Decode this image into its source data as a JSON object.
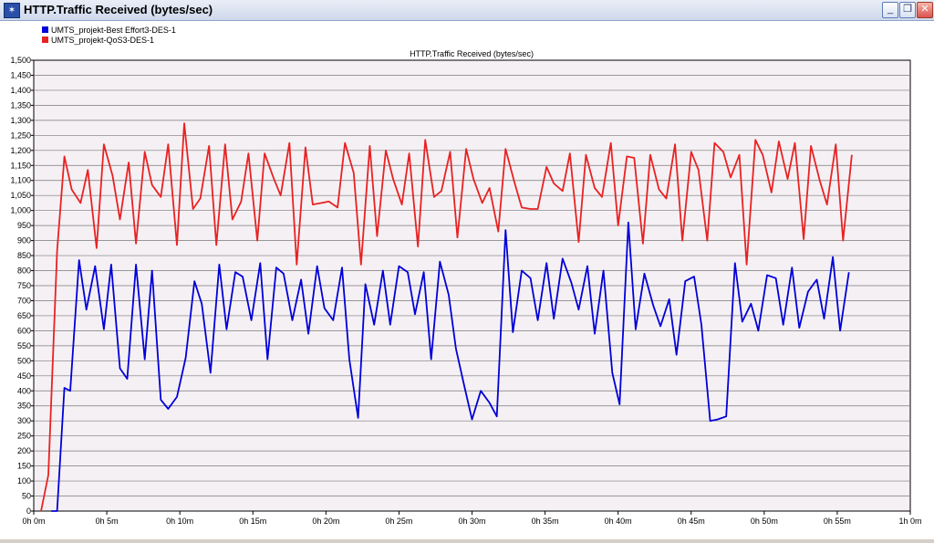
{
  "window": {
    "title": "HTTP.Traffic Received (bytes/sec)"
  },
  "colors": {
    "plot_bg": "#f5f0f4",
    "grid": "#7a7a7a",
    "series1": "#0000d8",
    "series2": "#e82222"
  },
  "chart_data": {
    "type": "line",
    "title": "HTTP.Traffic Received (bytes/sec)",
    "xlabel": "",
    "ylabel": "",
    "xlim": [
      0,
      60
    ],
    "ylim": [
      0,
      1500
    ],
    "grid": true,
    "legend_position": "top-left",
    "y_ticks": [
      0,
      50,
      100,
      150,
      200,
      250,
      300,
      350,
      400,
      450,
      500,
      550,
      600,
      650,
      700,
      750,
      800,
      850,
      900,
      950,
      1000,
      1050,
      1100,
      1150,
      1200,
      1250,
      1300,
      1350,
      1400,
      1450,
      1500
    ],
    "y_tick_labels": [
      "0",
      "50",
      "100",
      "150",
      "200",
      "250",
      "300",
      "350",
      "400",
      "450",
      "500",
      "550",
      "600",
      "650",
      "700",
      "750",
      "800",
      "850",
      "900",
      "950",
      "1,000",
      "1,050",
      "1,100",
      "1,150",
      "1,200",
      "1,250",
      "1,300",
      "1,350",
      "1,400",
      "1,450",
      "1,500"
    ],
    "x_ticks": [
      0,
      5,
      10,
      15,
      20,
      25,
      30,
      35,
      40,
      45,
      50,
      55,
      60
    ],
    "x_tick_labels": [
      "0h 0m",
      "0h 5m",
      "0h 10m",
      "0h 15m",
      "0h 20m",
      "0h 25m",
      "0h 30m",
      "0h 35m",
      "0h 40m",
      "0h 45m",
      "0h 50m",
      "0h 55m",
      "1h 0m"
    ],
    "series": [
      {
        "name": "UMTS_projekt-Best Effort3-DES-1",
        "color": "#0000d8",
        "points": [
          [
            1.2,
            0
          ],
          [
            1.6,
            0
          ],
          [
            2.1,
            410
          ],
          [
            2.5,
            400
          ],
          [
            3.1,
            835
          ],
          [
            3.6,
            670
          ],
          [
            4.2,
            815
          ],
          [
            4.8,
            605
          ],
          [
            5.3,
            820
          ],
          [
            5.9,
            475
          ],
          [
            6.4,
            440
          ],
          [
            7.0,
            820
          ],
          [
            7.6,
            505
          ],
          [
            8.1,
            800
          ],
          [
            8.7,
            370
          ],
          [
            9.2,
            340
          ],
          [
            9.8,
            380
          ],
          [
            10.4,
            510
          ],
          [
            11.0,
            765
          ],
          [
            11.5,
            690
          ],
          [
            12.1,
            460
          ],
          [
            12.7,
            820
          ],
          [
            13.2,
            605
          ],
          [
            13.8,
            795
          ],
          [
            14.3,
            780
          ],
          [
            14.9,
            635
          ],
          [
            15.5,
            825
          ],
          [
            16.0,
            505
          ],
          [
            16.6,
            810
          ],
          [
            17.1,
            790
          ],
          [
            17.7,
            635
          ],
          [
            18.3,
            770
          ],
          [
            18.8,
            590
          ],
          [
            19.4,
            815
          ],
          [
            19.9,
            675
          ],
          [
            20.5,
            635
          ],
          [
            21.1,
            810
          ],
          [
            21.6,
            505
          ],
          [
            22.2,
            310
          ],
          [
            22.7,
            755
          ],
          [
            23.3,
            620
          ],
          [
            23.9,
            800
          ],
          [
            24.4,
            620
          ],
          [
            25.0,
            815
          ],
          [
            25.6,
            795
          ],
          [
            26.1,
            655
          ],
          [
            26.7,
            795
          ],
          [
            27.2,
            505
          ],
          [
            27.8,
            830
          ],
          [
            28.4,
            720
          ],
          [
            28.9,
            540
          ],
          [
            29.5,
            410
          ],
          [
            30.0,
            305
          ],
          [
            30.6,
            400
          ],
          [
            31.2,
            360
          ],
          [
            31.7,
            315
          ],
          [
            32.3,
            935
          ],
          [
            32.8,
            595
          ],
          [
            33.4,
            800
          ],
          [
            34.0,
            775
          ],
          [
            34.5,
            635
          ],
          [
            35.1,
            825
          ],
          [
            35.6,
            640
          ],
          [
            36.2,
            840
          ],
          [
            36.8,
            760
          ],
          [
            37.3,
            670
          ],
          [
            37.9,
            815
          ],
          [
            38.4,
            590
          ],
          [
            39.0,
            800
          ],
          [
            39.6,
            460
          ],
          [
            40.1,
            355
          ],
          [
            40.7,
            960
          ],
          [
            41.2,
            605
          ],
          [
            41.8,
            790
          ],
          [
            42.4,
            685
          ],
          [
            42.9,
            615
          ],
          [
            43.5,
            705
          ],
          [
            44.0,
            520
          ],
          [
            44.6,
            765
          ],
          [
            45.2,
            780
          ],
          [
            45.7,
            620
          ],
          [
            46.3,
            300
          ],
          [
            46.8,
            305
          ],
          [
            47.4,
            315
          ],
          [
            48.0,
            825
          ],
          [
            48.5,
            630
          ],
          [
            49.1,
            690
          ],
          [
            49.6,
            600
          ],
          [
            50.2,
            785
          ],
          [
            50.8,
            775
          ],
          [
            51.3,
            620
          ],
          [
            51.9,
            810
          ],
          [
            52.4,
            610
          ],
          [
            53.0,
            730
          ],
          [
            53.6,
            770
          ],
          [
            54.1,
            640
          ],
          [
            54.7,
            845
          ],
          [
            55.2,
            600
          ],
          [
            55.8,
            795
          ]
        ]
      },
      {
        "name": "UMTS_projekt-QoS3-DES-1",
        "color": "#e82222",
        "points": [
          [
            0.5,
            0
          ],
          [
            1.0,
            120
          ],
          [
            1.6,
            865
          ],
          [
            2.1,
            1180
          ],
          [
            2.6,
            1070
          ],
          [
            3.2,
            1025
          ],
          [
            3.7,
            1135
          ],
          [
            4.3,
            875
          ],
          [
            4.8,
            1220
          ],
          [
            5.4,
            1115
          ],
          [
            5.9,
            970
          ],
          [
            6.5,
            1160
          ],
          [
            7.0,
            890
          ],
          [
            7.6,
            1195
          ],
          [
            8.1,
            1085
          ],
          [
            8.7,
            1045
          ],
          [
            9.2,
            1220
          ],
          [
            9.8,
            885
          ],
          [
            10.3,
            1290
          ],
          [
            10.9,
            1005
          ],
          [
            11.4,
            1040
          ],
          [
            12.0,
            1215
          ],
          [
            12.5,
            885
          ],
          [
            13.1,
            1220
          ],
          [
            13.6,
            970
          ],
          [
            14.2,
            1030
          ],
          [
            14.7,
            1190
          ],
          [
            15.3,
            900
          ],
          [
            15.8,
            1190
          ],
          [
            16.4,
            1110
          ],
          [
            16.9,
            1050
          ],
          [
            17.5,
            1225
          ],
          [
            18.0,
            820
          ],
          [
            18.6,
            1210
          ],
          [
            19.1,
            1020
          ],
          [
            19.7,
            1025
          ],
          [
            20.2,
            1030
          ],
          [
            20.8,
            1010
          ],
          [
            21.3,
            1225
          ],
          [
            21.9,
            1125
          ],
          [
            22.4,
            820
          ],
          [
            23.0,
            1215
          ],
          [
            23.5,
            915
          ],
          [
            24.1,
            1200
          ],
          [
            24.6,
            1105
          ],
          [
            25.2,
            1020
          ],
          [
            25.7,
            1190
          ],
          [
            26.3,
            880
          ],
          [
            26.8,
            1235
          ],
          [
            27.4,
            1045
          ],
          [
            27.9,
            1065
          ],
          [
            28.5,
            1195
          ],
          [
            29.0,
            910
          ],
          [
            29.6,
            1205
          ],
          [
            30.1,
            1105
          ],
          [
            30.7,
            1025
          ],
          [
            31.2,
            1075
          ],
          [
            31.8,
            930
          ],
          [
            32.3,
            1205
          ],
          [
            32.9,
            1095
          ],
          [
            33.4,
            1010
          ],
          [
            34.0,
            1005
          ],
          [
            34.5,
            1005
          ],
          [
            35.1,
            1145
          ],
          [
            35.6,
            1090
          ],
          [
            36.2,
            1065
          ],
          [
            36.7,
            1190
          ],
          [
            37.3,
            895
          ],
          [
            37.8,
            1185
          ],
          [
            38.4,
            1075
          ],
          [
            38.9,
            1045
          ],
          [
            39.5,
            1225
          ],
          [
            40.0,
            950
          ],
          [
            40.6,
            1180
          ],
          [
            41.1,
            1175
          ],
          [
            41.7,
            890
          ],
          [
            42.2,
            1185
          ],
          [
            42.8,
            1070
          ],
          [
            43.3,
            1040
          ],
          [
            43.9,
            1220
          ],
          [
            44.4,
            900
          ],
          [
            45.0,
            1195
          ],
          [
            45.5,
            1135
          ],
          [
            46.1,
            900
          ],
          [
            46.6,
            1225
          ],
          [
            47.2,
            1195
          ],
          [
            47.7,
            1110
          ],
          [
            48.3,
            1185
          ],
          [
            48.8,
            820
          ],
          [
            49.4,
            1235
          ],
          [
            49.9,
            1185
          ],
          [
            50.5,
            1060
          ],
          [
            51.0,
            1230
          ],
          [
            51.6,
            1105
          ],
          [
            52.1,
            1225
          ],
          [
            52.7,
            905
          ],
          [
            53.2,
            1215
          ],
          [
            53.8,
            1100
          ],
          [
            54.3,
            1020
          ],
          [
            54.9,
            1220
          ],
          [
            55.4,
            900
          ],
          [
            56.0,
            1185
          ]
        ]
      }
    ]
  }
}
